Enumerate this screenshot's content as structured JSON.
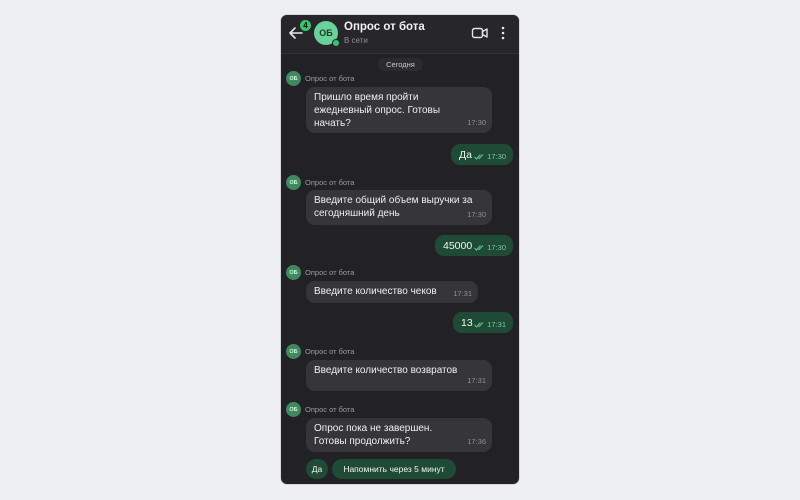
{
  "header": {
    "unread_count": "4",
    "avatar_initials": "ОБ",
    "title": "Опрос от бота",
    "status": "В сети"
  },
  "date_separator": "Сегодня",
  "messages": [
    {
      "from": "bot",
      "sender": "Опрос от бота",
      "avatar": "ОБ",
      "text": "Пришло время пройти ежедневный опрос. Готовы начать?",
      "time": "17:30"
    },
    {
      "from": "me",
      "text": "Да",
      "time": "17:30",
      "status": "read"
    },
    {
      "from": "bot",
      "sender": "Опрос от бота",
      "avatar": "ОБ",
      "text": "Введите общий объем выручки за сегодняшний день",
      "time": "17:30"
    },
    {
      "from": "me",
      "text": "45000",
      "time": "17:30",
      "status": "read"
    },
    {
      "from": "bot",
      "sender": "Опрос от бота",
      "avatar": "ОБ",
      "text": "Введите количество чеков",
      "time": "17:31"
    },
    {
      "from": "me",
      "text": "13",
      "time": "17:31",
      "status": "read"
    },
    {
      "from": "bot",
      "sender": "Опрос от бота",
      "avatar": "ОБ",
      "text": "Введите количество возвратов",
      "time": "17:31"
    },
    {
      "from": "bot",
      "sender": "Опрос от бота",
      "avatar": "ОБ",
      "text": "Опрос пока не завершен. Готовы продолжить?",
      "time": "17:36"
    }
  ],
  "quick_replies": [
    "Да",
    "Напомнить через 5 минут"
  ],
  "icons": {
    "back": "arrow-left-icon",
    "video": "video-camera-icon",
    "menu": "more-vertical-icon",
    "read": "double-check-icon"
  },
  "colors": {
    "background": "#eeeff2",
    "chat_bg": "#222226",
    "incoming_bubble": "#35353a",
    "outgoing_bubble": "#1f4a35",
    "accent": "#35c56b"
  }
}
